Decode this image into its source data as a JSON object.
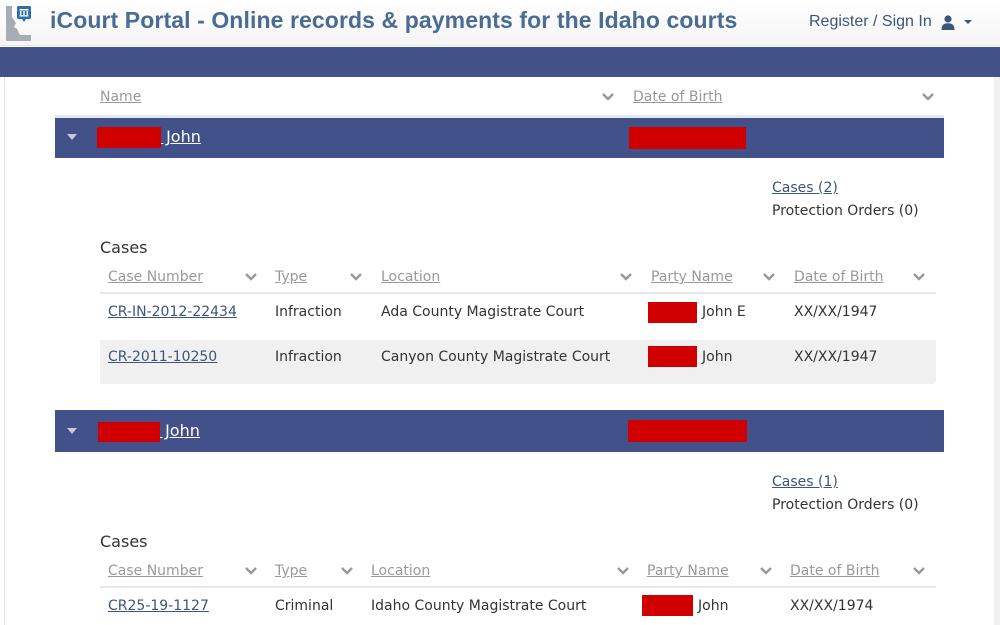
{
  "header": {
    "title": "iCourt Portal - Online records & payments for the Idaho courts",
    "signin_label": "Register / Sign In",
    "user_icon": "user-icon",
    "logo_icon": "idaho-courthouse-icon"
  },
  "colors": {
    "brand": "#42518a",
    "title": "#4a6b94",
    "link": "#3d5579",
    "redaction": "#d00000",
    "row_alt": "#f0f0f0"
  },
  "results_table": {
    "columns": [
      "Name",
      "Date of Birth"
    ]
  },
  "people": [
    {
      "name": " John",
      "name_redacted": true,
      "dob_redacted": true,
      "cases_link": "Cases (2)",
      "protection_orders": "Protection Orders (0)",
      "cases_title": "Cases",
      "case_columns": [
        "Case Number",
        "Type",
        "Location",
        "Party Name",
        "Date of Birth"
      ],
      "cases": [
        {
          "case_number": "CR-IN-2012-22434",
          "type": "Infraction",
          "location": "Ada County Magistrate Court",
          "party_name": "John E",
          "party_redacted": true,
          "dob": "XX/XX/1947"
        },
        {
          "case_number": "CR-2011-10250",
          "type": "Infraction",
          "location": "Canyon County Magistrate Court",
          "party_name": "John",
          "party_redacted": true,
          "dob": "XX/XX/1947"
        }
      ]
    },
    {
      "name": " John",
      "name_redacted": true,
      "dob_redacted": true,
      "cases_link": "Cases (1)",
      "protection_orders": "Protection Orders (0)",
      "cases_title": "Cases",
      "case_columns": [
        "Case Number",
        "Type",
        "Location",
        "Party Name",
        "Date of Birth"
      ],
      "cases": [
        {
          "case_number": "CR25-19-1127",
          "type": "Criminal",
          "location": "Idaho County Magistrate Court",
          "party_name": "John",
          "party_redacted": true,
          "dob": "XX/XX/1974"
        }
      ]
    }
  ]
}
